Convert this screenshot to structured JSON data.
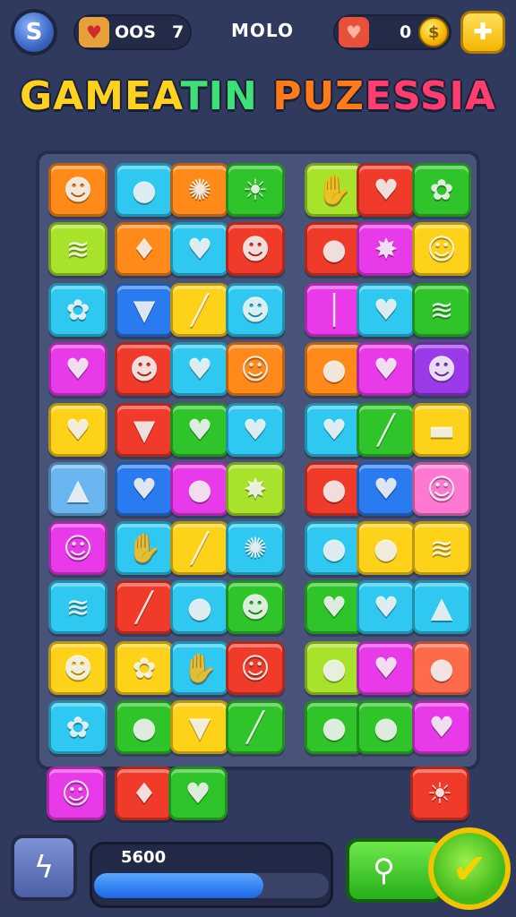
{
  "header": {
    "lives_value": "OOS",
    "level_value": "7",
    "mode_label": "MOLO",
    "coins_value": "0"
  },
  "title": {
    "segments": [
      {
        "text": "GAMEA",
        "color": "#ffd21f"
      },
      {
        "text": "TIN",
        "color": "#3ee07a"
      },
      {
        "text": " PUZ",
        "color": "#ff7a1a"
      },
      {
        "text": "ESSIA",
        "color": "#ff3d6e"
      }
    ]
  },
  "colors": {
    "orange": "#ff8a1a",
    "cyan": "#2fc8f0",
    "green": "#2fc52a",
    "red": "#f03a2a",
    "yellow": "#ffd21a",
    "magenta": "#e83ae8",
    "lime": "#a8e22a",
    "blue": "#2a7af0",
    "purple": "#9a3ae8",
    "pink": "#ff79d2",
    "skyblue": "#6ab6f0",
    "coral": "#ff6a4a"
  },
  "board": {
    "rows": [
      [
        {
          "c": "orange",
          "i": "☻"
        },
        {
          "c": "cyan",
          "i": "●"
        },
        {
          "c": "orange",
          "i": "✺"
        },
        {
          "c": "green",
          "i": "☀"
        },
        {
          "c": "lime",
          "i": "✋"
        },
        {
          "c": "red",
          "i": "♥"
        },
        {
          "c": "green",
          "i": "✿"
        }
      ],
      [
        {
          "c": "lime",
          "i": "≋"
        },
        {
          "c": "orange",
          "i": "♦"
        },
        {
          "c": "cyan",
          "i": "♥"
        },
        {
          "c": "red",
          "i": "☻"
        },
        {
          "c": "red",
          "i": "●"
        },
        {
          "c": "magenta",
          "i": "✸"
        },
        {
          "c": "yellow",
          "i": "☺"
        }
      ],
      [
        {
          "c": "cyan",
          "i": "✿"
        },
        {
          "c": "blue",
          "i": "▼"
        },
        {
          "c": "yellow",
          "i": "╱"
        },
        {
          "c": "cyan",
          "i": "☻"
        },
        {
          "c": "magenta",
          "i": "│"
        },
        {
          "c": "cyan",
          "i": "♥"
        },
        {
          "c": "green",
          "i": "≋"
        }
      ],
      [
        {
          "c": "magenta",
          "i": "♥"
        },
        {
          "c": "red",
          "i": "☻"
        },
        {
          "c": "cyan",
          "i": "♥"
        },
        {
          "c": "orange",
          "i": "☺"
        },
        {
          "c": "orange",
          "i": "●"
        },
        {
          "c": "magenta",
          "i": "♥"
        },
        {
          "c": "purple",
          "i": "☻"
        }
      ],
      [
        {
          "c": "yellow",
          "i": "♥"
        },
        {
          "c": "red",
          "i": "▼"
        },
        {
          "c": "green",
          "i": "♥"
        },
        {
          "c": "cyan",
          "i": "♥"
        },
        {
          "c": "cyan",
          "i": "♥"
        },
        {
          "c": "green",
          "i": "╱"
        },
        {
          "c": "yellow",
          "i": "▬"
        }
      ],
      [
        {
          "c": "skyblue",
          "i": "▲"
        },
        {
          "c": "blue",
          "i": "♥"
        },
        {
          "c": "magenta",
          "i": "●"
        },
        {
          "c": "lime",
          "i": "✸"
        },
        {
          "c": "red",
          "i": "●"
        },
        {
          "c": "blue",
          "i": "♥"
        },
        {
          "c": "pink",
          "i": "☺"
        }
      ],
      [
        {
          "c": "magenta",
          "i": "☺"
        },
        {
          "c": "cyan",
          "i": "✋"
        },
        {
          "c": "yellow",
          "i": "╱"
        },
        {
          "c": "cyan",
          "i": "✺"
        },
        {
          "c": "cyan",
          "i": "●"
        },
        {
          "c": "yellow",
          "i": "●"
        },
        {
          "c": "yellow",
          "i": "≋"
        }
      ],
      [
        {
          "c": "cyan",
          "i": "≋"
        },
        {
          "c": "red",
          "i": "╱"
        },
        {
          "c": "cyan",
          "i": "●"
        },
        {
          "c": "green",
          "i": "☻"
        },
        {
          "c": "green",
          "i": "♥"
        },
        {
          "c": "cyan",
          "i": "♥"
        },
        {
          "c": "cyan",
          "i": "▲"
        }
      ],
      [
        {
          "c": "yellow",
          "i": "☻"
        },
        {
          "c": "yellow",
          "i": "✿"
        },
        {
          "c": "cyan",
          "i": "✋"
        },
        {
          "c": "red",
          "i": "☺"
        },
        {
          "c": "lime",
          "i": "●"
        },
        {
          "c": "magenta",
          "i": "♥"
        },
        {
          "c": "coral",
          "i": "●"
        }
      ],
      [
        {
          "c": "cyan",
          "i": "✿"
        },
        {
          "c": "green",
          "i": "●"
        },
        {
          "c": "yellow",
          "i": "▼"
        },
        {
          "c": "green",
          "i": "╱"
        },
        {
          "c": "green",
          "i": "●"
        },
        {
          "c": "green",
          "i": "●"
        },
        {
          "c": "magenta",
          "i": "♥"
        }
      ]
    ],
    "extra_row": [
      {
        "col": 0,
        "c": "magenta",
        "i": "☺"
      },
      {
        "col": 1,
        "c": "red",
        "i": "♦"
      },
      {
        "col": 2,
        "c": "green",
        "i": "♥"
      },
      {
        "col": 6,
        "c": "red",
        "i": "☀"
      }
    ]
  },
  "footer": {
    "score_value": "5600",
    "progress": 0.72
  },
  "icons": {
    "avatar": "avatar-icon",
    "lives": "heart-badge-icon",
    "coin": "coin-icon",
    "settings": "settings-icon",
    "power": "lightning-icon",
    "hint": "key-icon",
    "confirm": "checkmark-icon"
  }
}
